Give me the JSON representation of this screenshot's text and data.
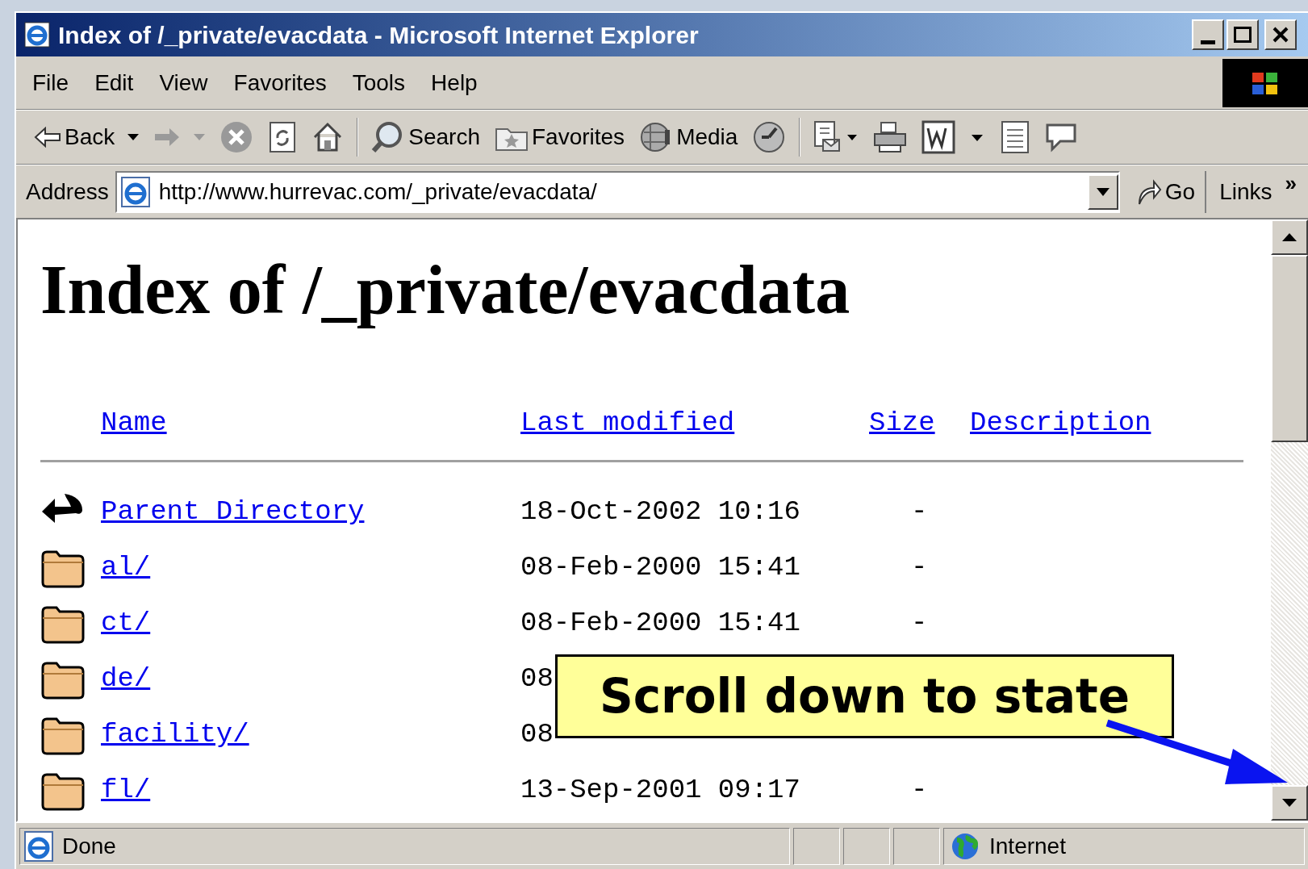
{
  "window": {
    "title": "Index of /_private/evacdata - Microsoft Internet Explorer"
  },
  "menu": [
    "File",
    "Edit",
    "View",
    "Favorites",
    "Tools",
    "Help"
  ],
  "toolbar": [
    {
      "kind": "back",
      "label": "Back"
    },
    {
      "kind": "forward"
    },
    {
      "kind": "stop"
    },
    {
      "kind": "refresh"
    },
    {
      "kind": "home"
    },
    {
      "kind": "search",
      "label": "Search"
    },
    {
      "kind": "favorites",
      "label": "Favorites"
    },
    {
      "kind": "media",
      "label": "Media"
    },
    {
      "kind": "history"
    },
    {
      "kind": "mail"
    },
    {
      "kind": "print"
    },
    {
      "kind": "edit"
    },
    {
      "kind": "notes"
    },
    {
      "kind": "discuss"
    }
  ],
  "address": {
    "label": "Address",
    "value": "http://www.hurrevac.com/_private/evacdata/",
    "go": "Go",
    "links": "Links",
    "chevron": "»"
  },
  "page": {
    "heading": "Index of /_private/evacdata",
    "columns": [
      "Name",
      "Last modified",
      "Size",
      "Description"
    ],
    "rows": [
      {
        "kind": "parent",
        "name": "Parent Directory",
        "modified": "18-Oct-2002 10:16",
        "size": "-"
      },
      {
        "kind": "folder",
        "name": "al/",
        "modified": "08-Feb-2000 15:41",
        "size": "-"
      },
      {
        "kind": "folder",
        "name": "ct/",
        "modified": "08-Feb-2000 15:41",
        "size": "-"
      },
      {
        "kind": "folder",
        "name": "de/",
        "modified": "08"
      },
      {
        "kind": "folder",
        "name": "facility/",
        "modified": "08"
      },
      {
        "kind": "folder",
        "name": "fl/",
        "modified": "13-Sep-2001 09:17",
        "size": "-"
      }
    ]
  },
  "callout": {
    "text": "Scroll down to state"
  },
  "status_bar": {
    "text": "Done",
    "zone": "Internet"
  }
}
